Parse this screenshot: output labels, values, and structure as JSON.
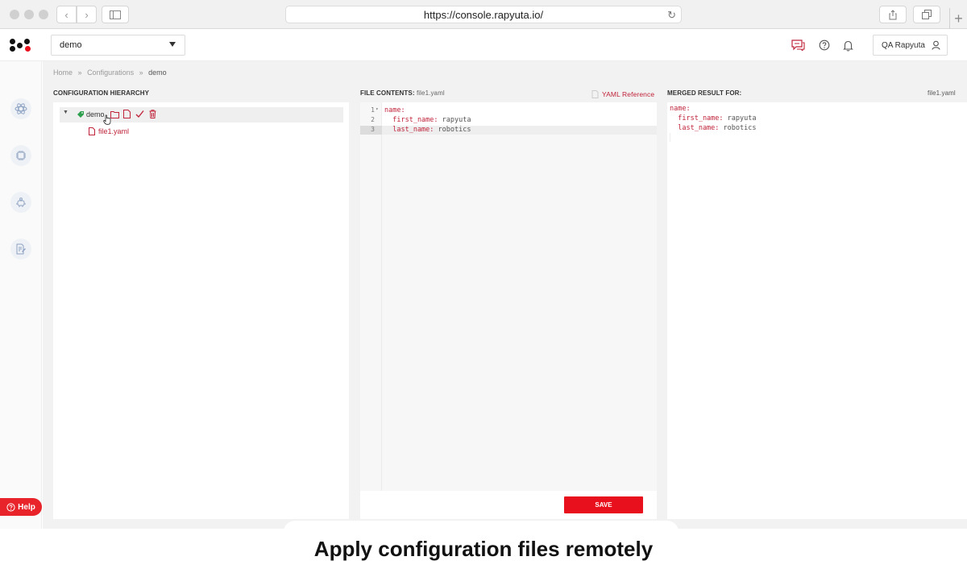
{
  "browser": {
    "url": "https://console.rapyuta.io/"
  },
  "header": {
    "project": "demo",
    "user": "QA Rapyuta"
  },
  "breadcrumb": {
    "home": "Home",
    "sep": "»",
    "configurations": "Configurations",
    "current": "demo"
  },
  "hierarchy": {
    "title": "CONFIGURATION HIERARCHY",
    "root": "demo",
    "file": "file1.yaml"
  },
  "editor": {
    "title_label": "FILE CONTENTS:",
    "title_file": "file1.yaml",
    "reference": "YAML Reference",
    "lines": [
      {
        "n": "1",
        "fold": "▾",
        "key": "name:",
        "val": ""
      },
      {
        "n": "2",
        "fold": "",
        "key": "  first_name:",
        "val": " rapyuta"
      },
      {
        "n": "3",
        "fold": "",
        "key": "  last_name:",
        "val": " robotics"
      }
    ],
    "save": "SAVE"
  },
  "merged": {
    "title": "MERGED RESULT FOR:",
    "file": "file1.yaml",
    "lines": [
      {
        "key": "name:",
        "val": ""
      },
      {
        "key": "  first_name:",
        "val": " rapyuta"
      },
      {
        "key": "  last_name:",
        "val": " robotics"
      }
    ]
  },
  "help": "Help",
  "caption": "Apply configuration files remotely",
  "colors": {
    "accent": "#e8101c",
    "file_red": "#c0233a",
    "tag_green": "#2e9e4f"
  },
  "icons": {
    "back": "chevron-left-icon",
    "forward": "chevron-right-icon",
    "sidebar": "sidebar-toggle-icon",
    "reload": "reload-icon",
    "share": "share-icon",
    "tabs": "tabs-icon",
    "feedback": "chat-icon",
    "help": "question-icon",
    "notifications": "bell-icon",
    "user": "user-icon"
  }
}
